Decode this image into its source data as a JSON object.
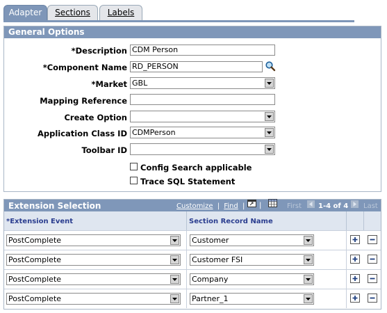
{
  "tabs": [
    {
      "label": "Adapter",
      "active": true
    },
    {
      "label": "Sections",
      "active": false,
      "accesskey": "S"
    },
    {
      "label": "Labels",
      "active": false,
      "accesskey": "L"
    }
  ],
  "general": {
    "title": "General Options",
    "description": {
      "label": "*Description",
      "value": "CDM Person"
    },
    "component_name": {
      "label": "*Component Name",
      "value": "RD_PERSON"
    },
    "market": {
      "label": "*Market",
      "value": "GBL"
    },
    "mapping_reference": {
      "label": "Mapping Reference",
      "value": ""
    },
    "create_option": {
      "label": "Create Option",
      "value": ""
    },
    "application_class_id": {
      "label": "Application Class ID",
      "value": "CDMPerson"
    },
    "toolbar_id": {
      "label": "Toolbar ID",
      "value": ""
    },
    "config_search": {
      "label": "Config Search applicable",
      "checked": false
    },
    "trace_sql": {
      "label": "Trace SQL Statement",
      "checked": false
    }
  },
  "extension": {
    "title": "Extension Selection",
    "customize": "Customize",
    "find": "Find",
    "first": "First",
    "range": "1-4 of 4",
    "last": "Last",
    "columns": [
      "*Extension Event",
      "Section Record Name"
    ],
    "rows": [
      {
        "event": "PostComplete",
        "record": "Customer"
      },
      {
        "event": "PostComplete",
        "record": "Customer FSI"
      },
      {
        "event": "PostComplete",
        "record": "Company"
      },
      {
        "event": "PostComplete",
        "record": "Partner_1"
      }
    ]
  },
  "colors": {
    "header": "#7f97b9",
    "tab_active": "#7e96b8",
    "grid_header": "#dfe6f0"
  }
}
